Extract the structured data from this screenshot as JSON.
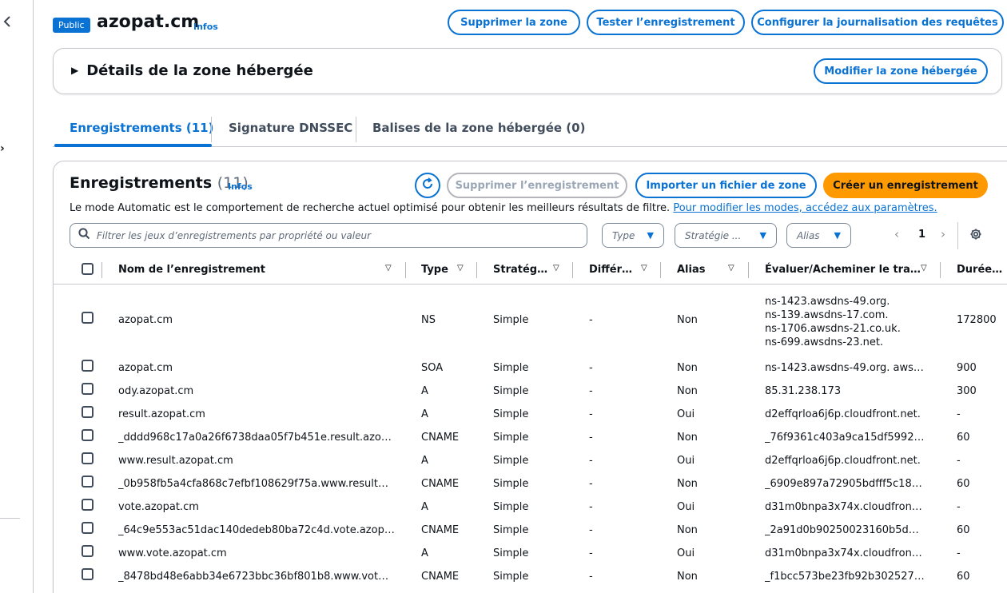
{
  "header": {
    "badge": "Public",
    "zone_name": "azopat.cm",
    "info": "Infos",
    "buttons": {
      "delete_zone": "Supprimer la zone",
      "test_record": "Tester l’enregistrement",
      "configure_logging": "Configurer la journalisation des requêtes"
    }
  },
  "details": {
    "title": "Détails de la zone hébergée",
    "edit_button": "Modifier la zone hébergée"
  },
  "tabs": [
    {
      "label": "Enregistrements (11)"
    },
    {
      "label": "Signature DNSSEC"
    },
    {
      "label": "Balises de la zone hébergée (0)"
    }
  ],
  "records": {
    "title": "Enregistrements",
    "count": "(11)",
    "info": "Infos",
    "buttons": {
      "delete_record": "Supprimer l’enregistrement",
      "import_zone": "Importer un fichier de zone",
      "create_record": "Créer un enregistrement"
    },
    "description": "Le mode Automatic est le comportement de recherche actuel optimisé pour obtenir les meilleurs résultats de filtre.",
    "description_link": "Pour modifier les modes, accédez aux paramètres.",
    "search_placeholder": "Filtrer les jeux d’enregistrements par propriété ou valeur",
    "filters": {
      "type": "Type",
      "strategy": "Stratégie ...",
      "alias": "Alias"
    },
    "page": "1",
    "columns": {
      "name": "Nom de l’enregistrement",
      "type": "Type",
      "strategy": "Stratég…",
      "diff": "Différ…",
      "alias": "Alias",
      "value": "Évaluer/Acheminer le tra…",
      "ttl": "Durée…"
    },
    "rows": [
      {
        "name": "azopat.cm",
        "type": "NS",
        "strategy": "Simple",
        "diff": "-",
        "alias": "Non",
        "value_lines": [
          "ns-1423.awsdns-49.org.",
          "ns-139.awsdns-17.com.",
          "ns-1706.awsdns-21.co.uk.",
          "ns-699.awsdns-23.net."
        ],
        "ttl": "172800"
      },
      {
        "name": "azopat.cm",
        "type": "SOA",
        "strategy": "Simple",
        "diff": "-",
        "alias": "Non",
        "value": "ns-1423.awsdns-49.org. aws…",
        "ttl": "900"
      },
      {
        "name": "ody.azopat.cm",
        "type": "A",
        "strategy": "Simple",
        "diff": "-",
        "alias": "Non",
        "value": "85.31.238.173",
        "ttl": "300"
      },
      {
        "name": "result.azopat.cm",
        "type": "A",
        "strategy": "Simple",
        "diff": "-",
        "alias": "Oui",
        "value": "d2effqrloa6j6p.cloudfront.net.",
        "ttl": "-"
      },
      {
        "name": "_dddd968c17a0a26f6738daa05f7b451e.result.azo…",
        "type": "CNAME",
        "strategy": "Simple",
        "diff": "-",
        "alias": "Non",
        "value": "_76f9361c403a9ca15df5992…",
        "ttl": "60"
      },
      {
        "name": "www.result.azopat.cm",
        "type": "A",
        "strategy": "Simple",
        "diff": "-",
        "alias": "Oui",
        "value": "d2effqrloa6j6p.cloudfront.net.",
        "ttl": "-"
      },
      {
        "name": "_0b958fb5a4cfa868c7efbf108629f75a.www.result…",
        "type": "CNAME",
        "strategy": "Simple",
        "diff": "-",
        "alias": "Non",
        "value": "_6909e897a72905bdfff5c18…",
        "ttl": "60"
      },
      {
        "name": "vote.azopat.cm",
        "type": "A",
        "strategy": "Simple",
        "diff": "-",
        "alias": "Oui",
        "value": "d31m0bnpa3x74x.cloudfron…",
        "ttl": "-"
      },
      {
        "name": "_64c9e553ac51dac140dedeb80ba72c4d.vote.azop…",
        "type": "CNAME",
        "strategy": "Simple",
        "diff": "-",
        "alias": "Non",
        "value": "_2a91d0b90250023160b5d…",
        "ttl": "60"
      },
      {
        "name": "www.vote.azopat.cm",
        "type": "A",
        "strategy": "Simple",
        "diff": "-",
        "alias": "Oui",
        "value": "d31m0bnpa3x74x.cloudfron…",
        "ttl": "-"
      },
      {
        "name": "_8478bd48e6abb34e6723bbc36bf801b8.www.vot…",
        "type": "CNAME",
        "strategy": "Simple",
        "diff": "-",
        "alias": "Non",
        "value": "_f1bcc573be23fb92b302527…",
        "ttl": "60"
      }
    ]
  },
  "colors": {
    "primary": "#0972d3",
    "accent": "#ff9900",
    "text": "#0f141a",
    "muted": "#5f6b7a"
  }
}
